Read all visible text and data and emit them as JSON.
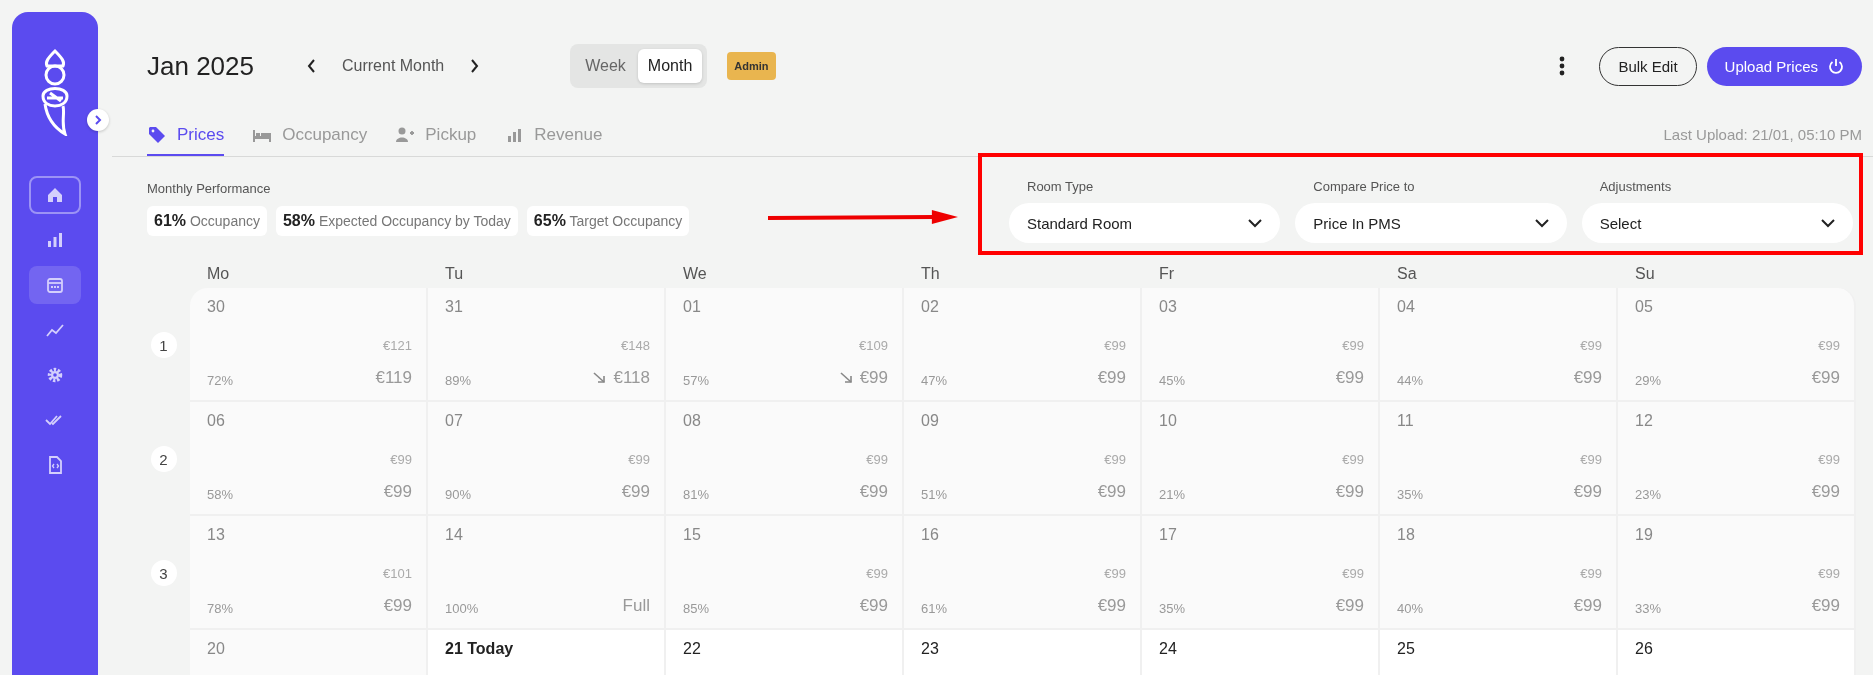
{
  "sidebar": {
    "items": [
      {
        "kind": "home",
        "selected": false,
        "outlined": true
      },
      {
        "kind": "bars",
        "selected": false,
        "outlined": false
      },
      {
        "kind": "calendar",
        "selected": true,
        "outlined": false
      },
      {
        "kind": "trend",
        "selected": false,
        "outlined": false
      },
      {
        "kind": "gear",
        "selected": false,
        "outlined": false
      },
      {
        "kind": "checks",
        "selected": false,
        "outlined": false
      },
      {
        "kind": "file",
        "selected": false,
        "outlined": false
      }
    ]
  },
  "header": {
    "title": "Jan 2025",
    "period_label": "Current Month",
    "view_toggle": [
      {
        "label": "Week",
        "selected": false
      },
      {
        "label": "Month",
        "selected": true
      }
    ],
    "role_badge": "Admin",
    "buttons": {
      "secondary": "Bulk Edit",
      "primary": "Upload Prices"
    }
  },
  "tabs": [
    {
      "label": "Prices",
      "kind": "tag",
      "selected": true
    },
    {
      "label": "Occupancy",
      "kind": "bed",
      "selected": false
    },
    {
      "label": "Pickup",
      "kind": "user-plus",
      "selected": false
    },
    {
      "label": "Revenue",
      "kind": "bars",
      "selected": false
    }
  ],
  "last_upload": "Last Upload: 21/01, 05:10 PM",
  "performance": {
    "title": "Monthly Performance",
    "chips": [
      "**61%** Occupancy",
      "**58%** Expected Occupancy by Today",
      "**65%** Target Occupancy"
    ]
  },
  "filters": [
    {
      "label": "Room Type",
      "value": "Standard Room"
    },
    {
      "label": "Compare Price to",
      "value": "Price In PMS"
    },
    {
      "label": "Adjustments",
      "value": "Select"
    }
  ],
  "calendar": {
    "weekdays": [
      "Mo",
      "Tu",
      "We",
      "Th",
      "Fr",
      "Sa",
      "Su"
    ],
    "weeks": [
      {
        "number": "1",
        "days": [
          {
            "day": "30",
            "past": true,
            "today": false,
            "list_price": "€121",
            "price": "€119",
            "occupancy": "72%",
            "price_down": false
          },
          {
            "day": "31",
            "past": true,
            "today": false,
            "list_price": "€148",
            "price": "€118",
            "occupancy": "89%",
            "price_down": true
          },
          {
            "day": "01",
            "past": true,
            "today": false,
            "list_price": "€109",
            "price": "€99",
            "occupancy": "57%",
            "price_down": true
          },
          {
            "day": "02",
            "past": true,
            "today": false,
            "list_price": "€99",
            "price": "€99",
            "occupancy": "47%",
            "price_down": false
          },
          {
            "day": "03",
            "past": true,
            "today": false,
            "list_price": "€99",
            "price": "€99",
            "occupancy": "45%",
            "price_down": false
          },
          {
            "day": "04",
            "past": true,
            "today": false,
            "list_price": "€99",
            "price": "€99",
            "occupancy": "44%",
            "price_down": false
          },
          {
            "day": "05",
            "past": true,
            "today": false,
            "list_price": "€99",
            "price": "€99",
            "occupancy": "29%",
            "price_down": false
          }
        ]
      },
      {
        "number": "2",
        "days": [
          {
            "day": "06",
            "past": true,
            "today": false,
            "list_price": "€99",
            "price": "€99",
            "occupancy": "58%",
            "price_down": false
          },
          {
            "day": "07",
            "past": true,
            "today": false,
            "list_price": "€99",
            "price": "€99",
            "occupancy": "90%",
            "price_down": false
          },
          {
            "day": "08",
            "past": true,
            "today": false,
            "list_price": "€99",
            "price": "€99",
            "occupancy": "81%",
            "price_down": false
          },
          {
            "day": "09",
            "past": true,
            "today": false,
            "list_price": "€99",
            "price": "€99",
            "occupancy": "51%",
            "price_down": false
          },
          {
            "day": "10",
            "past": true,
            "today": false,
            "list_price": "€99",
            "price": "€99",
            "occupancy": "21%",
            "price_down": false
          },
          {
            "day": "11",
            "past": true,
            "today": false,
            "list_price": "€99",
            "price": "€99",
            "occupancy": "35%",
            "price_down": false
          },
          {
            "day": "12",
            "past": true,
            "today": false,
            "list_price": "€99",
            "price": "€99",
            "occupancy": "23%",
            "price_down": false
          }
        ]
      },
      {
        "number": "3",
        "days": [
          {
            "day": "13",
            "past": true,
            "today": false,
            "list_price": "€101",
            "price": "€99",
            "occupancy": "78%",
            "price_down": false
          },
          {
            "day": "14",
            "past": true,
            "today": false,
            "price": "Full",
            "occupancy": "100%",
            "price_down": false
          },
          {
            "day": "15",
            "past": true,
            "today": false,
            "list_price": "€99",
            "price": "€99",
            "occupancy": "85%",
            "price_down": false
          },
          {
            "day": "16",
            "past": true,
            "today": false,
            "list_price": "€99",
            "price": "€99",
            "occupancy": "61%",
            "price_down": false
          },
          {
            "day": "17",
            "past": true,
            "today": false,
            "list_price": "€99",
            "price": "€99",
            "occupancy": "35%",
            "price_down": false
          },
          {
            "day": "18",
            "past": true,
            "today": false,
            "list_price": "€99",
            "price": "€99",
            "occupancy": "40%",
            "price_down": false
          },
          {
            "day": "19",
            "past": true,
            "today": false,
            "list_price": "€99",
            "price": "€99",
            "occupancy": "33%",
            "price_down": false
          }
        ]
      },
      {
        "days": [
          {
            "day": "20",
            "past": true,
            "today": false
          },
          {
            "day": "21 Today",
            "past": false,
            "today": true
          },
          {
            "day": "22",
            "past": false,
            "today": false
          },
          {
            "day": "23",
            "past": false,
            "today": false
          },
          {
            "day": "24",
            "past": false,
            "today": false
          },
          {
            "day": "25",
            "past": false,
            "today": false
          },
          {
            "day": "26",
            "past": false,
            "today": false
          }
        ]
      }
    ]
  }
}
